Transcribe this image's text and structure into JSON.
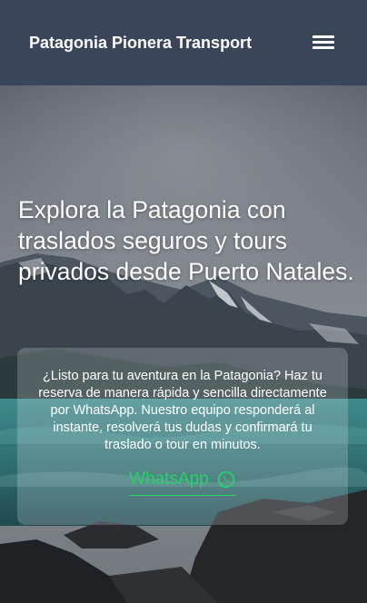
{
  "header": {
    "brand": "Patagonia Pionera Transport",
    "menu_icon": "hamburger-menu-icon"
  },
  "hero": {
    "title": "Explora la Patagonia con traslados seguros y tours privados desde Puerto Natales."
  },
  "card": {
    "text": "¿Listo para tu aventura en la Patagonia? Haz tu reserva de manera rápida y sencilla directamente por WhatsApp. Nuestro equipo responderá al instante, resolverá tus dudas y confirmará tu traslado o tour en minutos.",
    "cta_label": "WhatsApp",
    "cta_icon": "whatsapp-icon"
  },
  "colors": {
    "header_bg": "#3b4559",
    "accent_green": "#25d366"
  }
}
